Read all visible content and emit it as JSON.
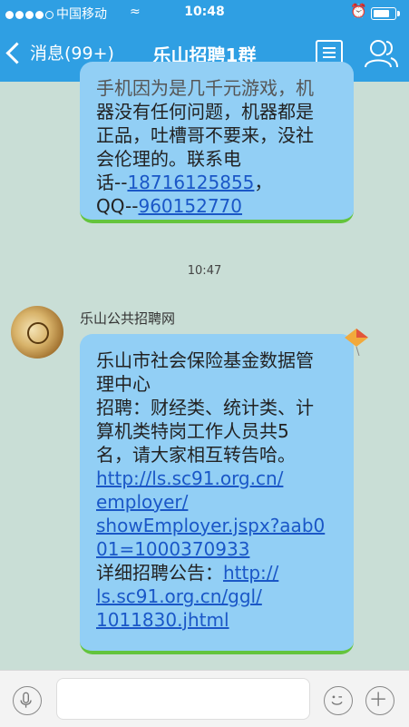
{
  "status_bar": {
    "carrier": "中国移动",
    "time": "10:48",
    "battery_level": 0.85
  },
  "nav": {
    "back_label": "消息(99+)",
    "title": "乐山招聘1群"
  },
  "messages": {
    "first": {
      "partial_line": "手机因为是几千元游戏，机",
      "text_lines": [
        "器没有任何问题，机器都是",
        "正品，吐槽哥不要来，没社",
        "会伦理的。联系电"
      ],
      "phone_prefix": "话--",
      "phone": "18716125855",
      "phone_suffix": "，",
      "qq_prefix": "QQ--",
      "qq": "960152770"
    },
    "timestamp": "10:47",
    "second": {
      "sender": "乐山公共招聘网",
      "line1": "乐山市社会保险基金数据管",
      "line2": "理中心",
      "line3": "招聘：财经类、统计类、计",
      "line4": "算机类特岗工作人员共5",
      "line5": "名，请大家相互转告哈。",
      "link1_line1": "http://ls.sc91.org.cn/",
      "link1_line2": "employer/",
      "link1_line3": "showEmployer.jspx?aab0",
      "link1_line4": "01=1000370933",
      "notice_label": "详细招聘公告：",
      "link2_line1": "http://",
      "link2_line2": "ls.sc91.org.cn/ggl/",
      "link2_line3": "1011830.jhtml"
    }
  },
  "input": {
    "placeholder": ""
  },
  "colors": {
    "bar": "#2f9fe3",
    "bubble": "#92cff5",
    "bubble_edge": "#63c43d",
    "link": "#1a57c7"
  }
}
